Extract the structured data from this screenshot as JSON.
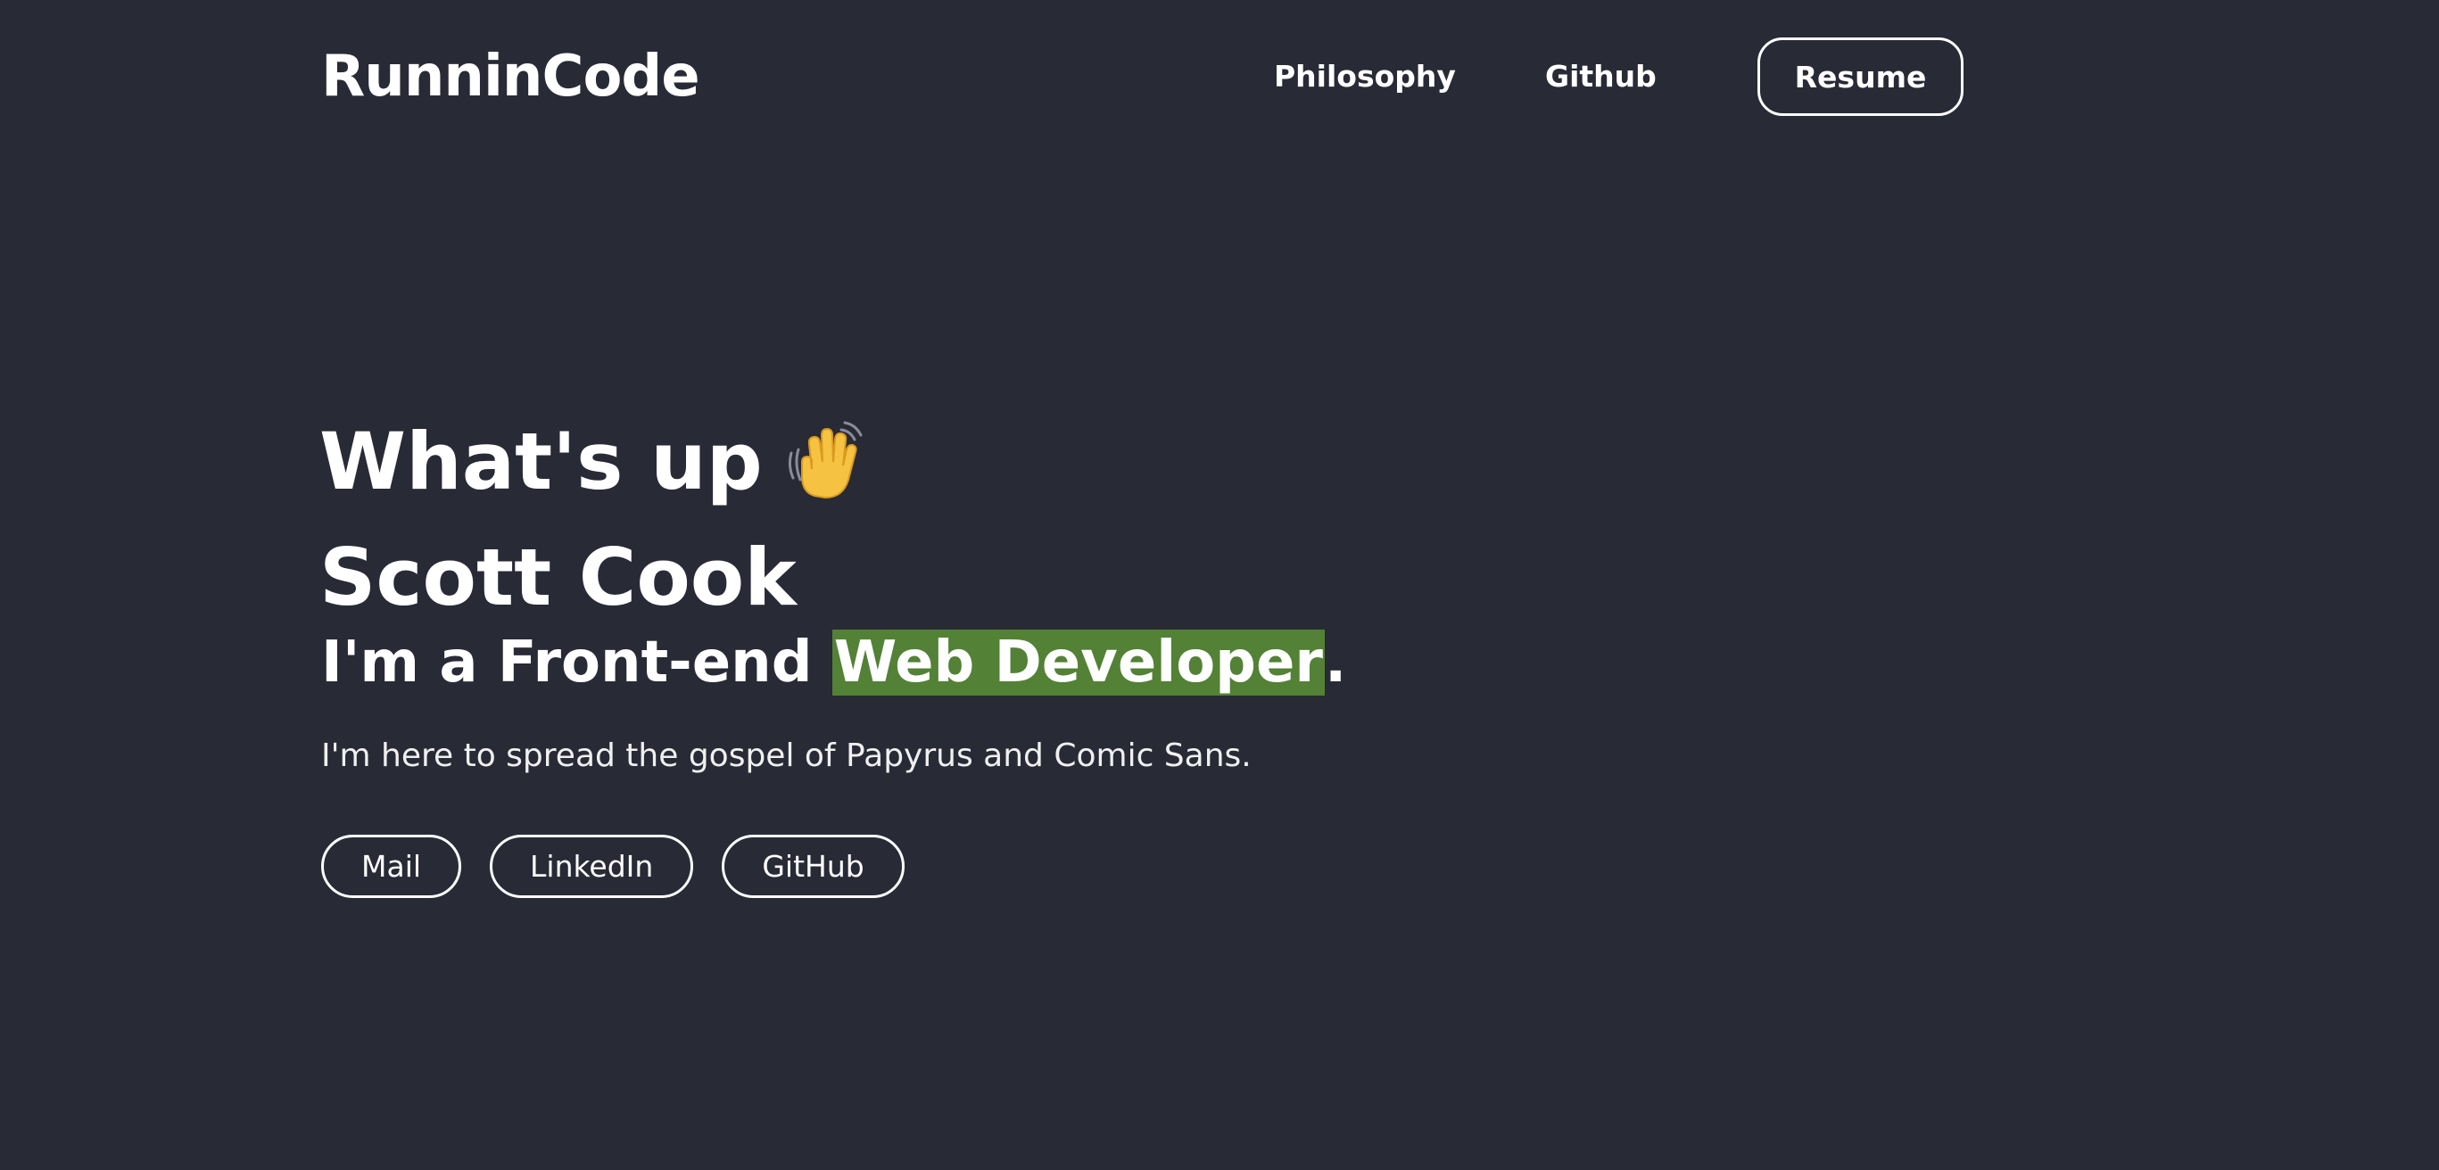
{
  "header": {
    "brand": "RunninCode",
    "nav": {
      "philosophy": "Philosophy",
      "github": "Github",
      "resume": "Resume"
    }
  },
  "hero": {
    "greeting": "What's up",
    "greeting_icon": "waving-hand-icon",
    "name": "Scott Cook",
    "tagline_prefix": "I'm a Front-end ",
    "tagline_highlight": "Web Developer",
    "tagline_suffix": ".",
    "intro": "I'm here to spread the gospel of Papyrus and Comic Sans."
  },
  "social": {
    "mail": "Mail",
    "linkedin": "LinkedIn",
    "github": "GitHub"
  },
  "colors": {
    "background": "#282a36",
    "text": "#ffffff",
    "highlight": "#538135"
  }
}
